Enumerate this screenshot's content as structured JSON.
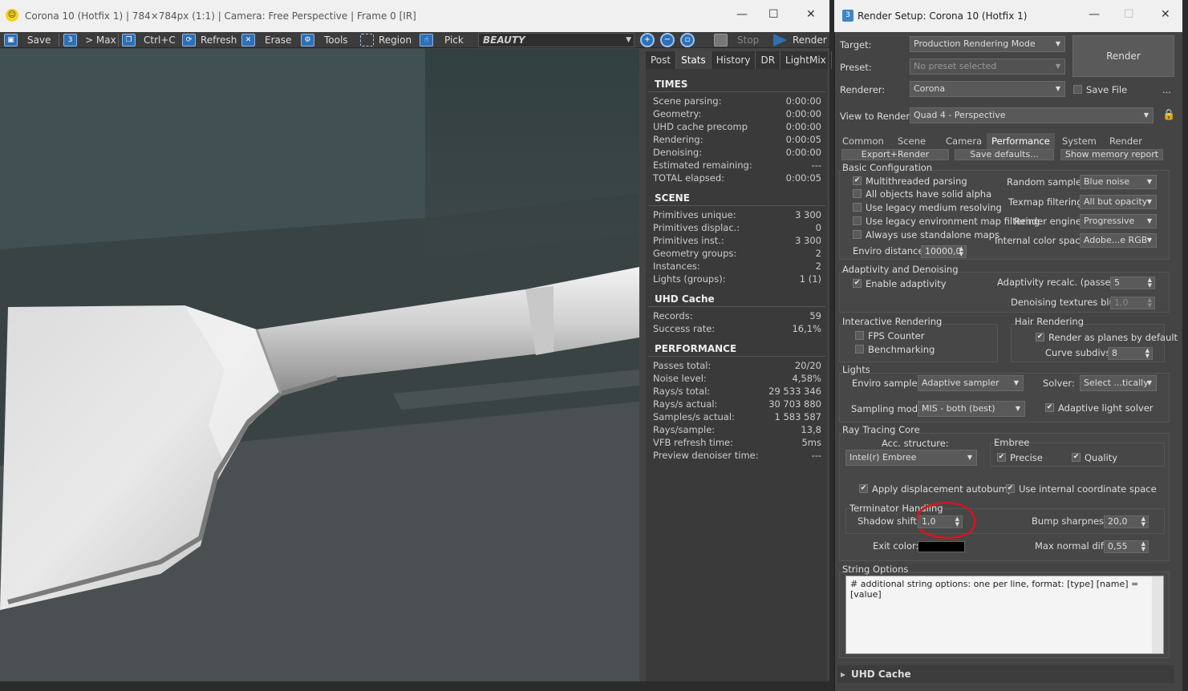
{
  "vfb": {
    "title": "Corona 10 (Hotfix 1) | 784×784px (1:1) | Camera: Free Perspective | Frame 0 [IR]",
    "toolbar": {
      "save": "Save",
      "max": "> Max",
      "copy": "Ctrl+C",
      "refresh": "Refresh",
      "erase": "Erase",
      "tools": "Tools",
      "region": "Region",
      "pick": "Pick",
      "channel": "BEAUTY",
      "stop": "Stop",
      "render": "Render"
    },
    "tabs": [
      "Post",
      "Stats",
      "History",
      "DR",
      "LightMix"
    ],
    "active_tab": "Stats",
    "stats": {
      "times": {
        "heading": "TIMES",
        "rows": [
          {
            "label": "Scene parsing:",
            "value": "0:00:00"
          },
          {
            "label": "Geometry:",
            "value": "0:00:00"
          },
          {
            "label": "UHD cache precomp",
            "value": "0:00:00"
          },
          {
            "label": "Rendering:",
            "value": "0:00:05"
          },
          {
            "label": "Denoising:",
            "value": "0:00:00"
          },
          {
            "label": "Estimated remaining:",
            "value": "---"
          },
          {
            "label": "TOTAL elapsed:",
            "value": "0:00:05"
          }
        ]
      },
      "scene": {
        "heading": "SCENE",
        "rows": [
          {
            "label": "Primitives unique:",
            "value": "3 300"
          },
          {
            "label": "Primitives displac.:",
            "value": "0"
          },
          {
            "label": "Primitives inst.:",
            "value": "3 300"
          },
          {
            "label": "Geometry groups:",
            "value": "2"
          },
          {
            "label": "Instances:",
            "value": "2"
          },
          {
            "label": "Lights (groups):",
            "value": "1 (1)"
          }
        ]
      },
      "uhd": {
        "heading": "UHD Cache",
        "rows": [
          {
            "label": "Records:",
            "value": "59"
          },
          {
            "label": "Success rate:",
            "value": "16,1%"
          }
        ]
      },
      "performance": {
        "heading": "PERFORMANCE",
        "rows": [
          {
            "label": "Passes total:",
            "value": "20/20"
          },
          {
            "label": "Noise level:",
            "value": "4,58%"
          },
          {
            "label": "Rays/s total:",
            "value": "29 533 346"
          },
          {
            "label": "Rays/s actual:",
            "value": "30 703 880"
          },
          {
            "label": "Samples/s actual:",
            "value": "1 583 587"
          },
          {
            "label": "Rays/sample:",
            "value": "13,8"
          },
          {
            "label": "VFB refresh time:",
            "value": "5ms"
          },
          {
            "label": "Preview denoiser time:",
            "value": "---"
          }
        ]
      }
    }
  },
  "render_setup": {
    "title": "Render Setup: Corona 10 (Hotfix 1)",
    "target_label": "Target:",
    "target_value": "Production Rendering Mode",
    "preset_label": "Preset:",
    "preset_value": "No preset selected",
    "renderer_label": "Renderer:",
    "renderer_value": "Corona",
    "save_file": "Save File",
    "ellipsis": "...",
    "view_label": "View to Render:",
    "view_value": "Quad 4 - Perspective",
    "render_button": "Render",
    "tabs": [
      "Common",
      "Scene",
      "Camera",
      "Performance",
      "System",
      "Render Elements"
    ],
    "active_tab": "Performance",
    "top_buttons": [
      "Export+Render",
      "Save defaults...",
      "Show memory report"
    ],
    "basic": {
      "title": "Basic Configuration",
      "multithreaded": "Multithreaded parsing",
      "solid_alpha": "All objects have solid alpha",
      "legacy_medium": "Use legacy medium resolving",
      "legacy_env": "Use legacy environment map filtering",
      "standalone": "Always use standalone maps",
      "enviro_dist_label": "Enviro distance:",
      "enviro_dist_value": "10000,0",
      "random_sampler_label": "Random sampler:",
      "random_sampler_value": "Blue noise",
      "texmap_label": "Texmap filtering:",
      "texmap_value": "All but opacity",
      "engine_label": "Render engine:",
      "engine_value": "Progressive",
      "color_space_label": "Internal color space:",
      "color_space_value": "Adobe...e RGB"
    },
    "adaptivity": {
      "title": "Adaptivity and Denoising",
      "enable": "Enable adaptivity",
      "recalc_label": "Adaptivity recalc. (passes):",
      "recalc_value": "5",
      "blur_label": "Denoising textures blur:",
      "blur_value": "1,0"
    },
    "interactive": {
      "title": "Interactive Rendering",
      "fps": "FPS Counter",
      "bench": "Benchmarking"
    },
    "hair": {
      "title": "Hair Rendering",
      "planes": "Render as planes by default",
      "subdivs_label": "Curve subdivs:",
      "subdivs_value": "8"
    },
    "lights": {
      "title": "Lights",
      "enviro_label": "Enviro sampler:",
      "enviro_value": "Adaptive sampler",
      "solver_label": "Solver:",
      "solver_value": "Select ...tically",
      "mode_label": "Sampling mode:",
      "mode_value": "MIS - both (best)",
      "adaptive_solver": "Adaptive light solver"
    },
    "raytracing": {
      "title": "Ray Tracing Core",
      "acc_label": "Acc. structure:",
      "acc_value": "Intel(r) Embree",
      "embree_title": "Embree",
      "precise": "Precise",
      "quality": "Quality",
      "autobump": "Apply displacement autobump",
      "internal_coord": "Use internal coordinate space",
      "terminator_title": "Terminator Handling",
      "shadow_label": "Shadow shift:",
      "shadow_value": "1,0",
      "bump_label": "Bump sharpness:",
      "bump_value": "20,0",
      "exit_label": "Exit color:",
      "maxnormal_label": "Max normal diff:",
      "maxnormal_value": "0,55"
    },
    "string_options": {
      "title": "String Options",
      "text": "# additional string options: one per line, format: [type] [name] = [value]"
    },
    "uhd_cache": "UHD Cache"
  },
  "colors": {
    "annotation": "#d8141a",
    "exit_color": "#000000"
  }
}
